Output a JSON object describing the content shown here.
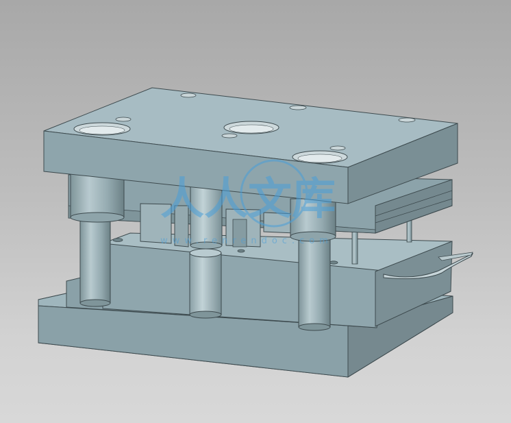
{
  "viewport": {
    "background_top": "#a8a8a8",
    "background_bottom": "#d8d8d8"
  },
  "model": {
    "type": "stamping-die-assembly",
    "colors": {
      "face_top": "#9fb6bd",
      "face_front": "#8aa1a8",
      "face_side": "#7a9096",
      "edge": "#3d4a4e",
      "pillar_light": "#b5c7cc",
      "pillar_dark": "#6f8489"
    }
  },
  "watermark": {
    "logo_text": "人人文库",
    "url_text": "www.renrendoc.com",
    "color": "#4a9fd8"
  }
}
